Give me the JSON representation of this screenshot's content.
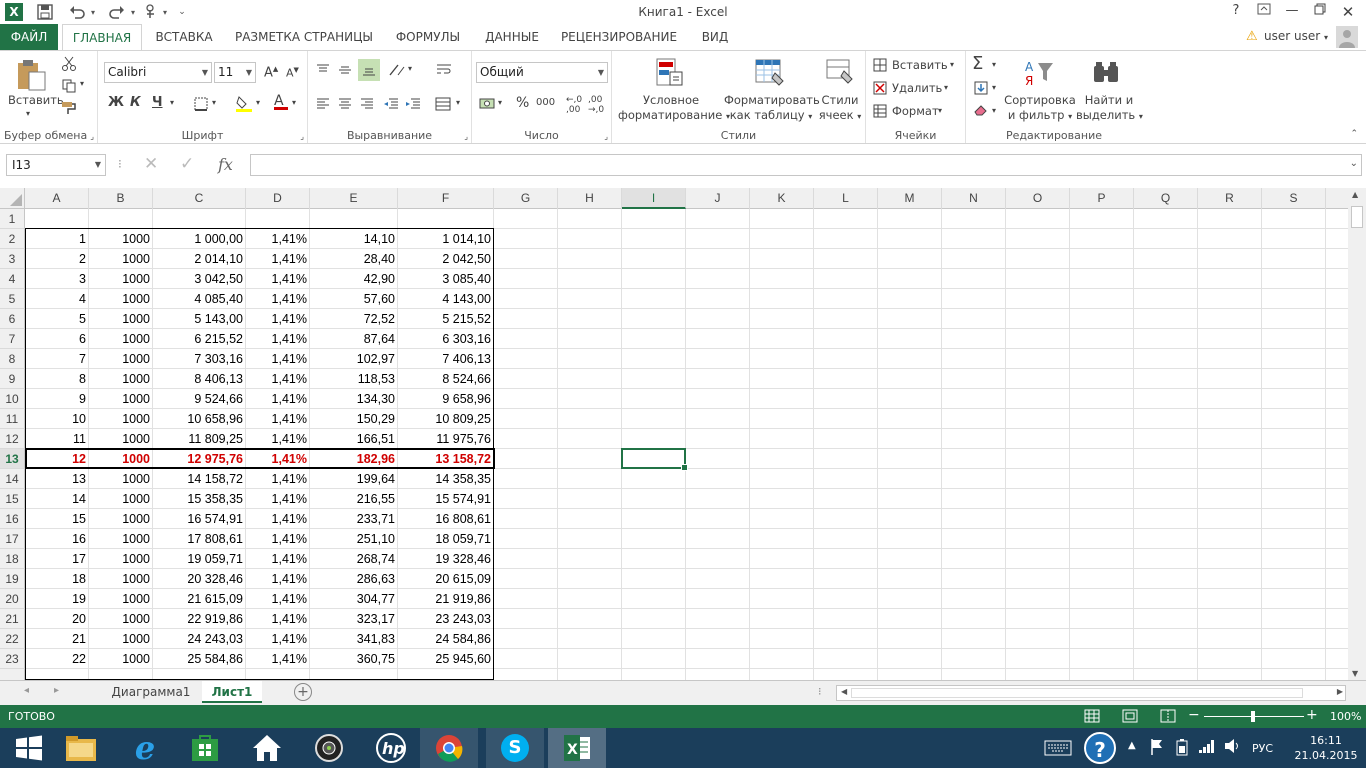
{
  "window": {
    "title": "Книга1 - Excel",
    "help_label": "?",
    "excel_logo": "X"
  },
  "ribbon_tabs": [
    {
      "label": "ФАЙЛ"
    },
    {
      "label": "ГЛАВНАЯ"
    },
    {
      "label": "ВСТАВКА"
    },
    {
      "label": "РАЗМЕТКА СТРАНИЦЫ"
    },
    {
      "label": "ФОРМУЛЫ"
    },
    {
      "label": "ДАННЫЕ"
    },
    {
      "label": "РЕЦЕНЗИРОВАНИЕ"
    },
    {
      "label": "ВИД"
    }
  ],
  "user": {
    "name": "user user"
  },
  "ribbon": {
    "clipboard": {
      "label": "Буфер обмена",
      "paste_label": "Вставить"
    },
    "font": {
      "label": "Шрифт",
      "font_name": "Calibri",
      "font_size": "11",
      "bold": "Ж",
      "italic": "К",
      "underline": "Ч",
      "grow": "A",
      "shrink": "A",
      "font_color": "A"
    },
    "alignment": {
      "label": "Выравнивание"
    },
    "number": {
      "label": "Число",
      "format": "Общий",
      "percent": "%",
      "thousands": "000",
      "currency": "₽"
    },
    "styles": {
      "label": "Стили",
      "conditional": [
        "Условное",
        "форматирование"
      ],
      "as_table": [
        "Форматировать",
        "как таблицу"
      ],
      "cell_styles": [
        "Стили",
        "ячеек"
      ]
    },
    "cells": {
      "label": "Ячейки",
      "insert": "Вставить",
      "delete": "Удалить",
      "format": "Формат"
    },
    "editing": {
      "label": "Редактирование",
      "sum": "Σ",
      "sort": [
        "Сортировка",
        "и фильтр"
      ],
      "find": [
        "Найти и",
        "выделить"
      ]
    }
  },
  "formula_bar": {
    "name_box": "I13",
    "fx": "fx",
    "formula": ""
  },
  "columns": [
    "A",
    "B",
    "C",
    "D",
    "E",
    "F",
    "G",
    "H",
    "I",
    "J",
    "K",
    "L",
    "M",
    "N",
    "O",
    "P",
    "Q",
    "R",
    "S"
  ],
  "selected_cell": {
    "column": "I",
    "row": 13
  },
  "rows": [
    {
      "n": "1",
      "cells": [
        "",
        "",
        "",
        "",
        "",
        ""
      ]
    },
    {
      "n": "2",
      "cells": [
        "1",
        "1000",
        "1 000,00",
        "1,41%",
        "14,10",
        "1 014,10"
      ]
    },
    {
      "n": "3",
      "cells": [
        "2",
        "1000",
        "2 014,10",
        "1,41%",
        "28,40",
        "2 042,50"
      ]
    },
    {
      "n": "4",
      "cells": [
        "3",
        "1000",
        "3 042,50",
        "1,41%",
        "42,90",
        "3 085,40"
      ]
    },
    {
      "n": "5",
      "cells": [
        "4",
        "1000",
        "4 085,40",
        "1,41%",
        "57,60",
        "4 143,00"
      ]
    },
    {
      "n": "6",
      "cells": [
        "5",
        "1000",
        "5 143,00",
        "1,41%",
        "72,52",
        "5 215,52"
      ]
    },
    {
      "n": "7",
      "cells": [
        "6",
        "1000",
        "6 215,52",
        "1,41%",
        "87,64",
        "6 303,16"
      ]
    },
    {
      "n": "8",
      "cells": [
        "7",
        "1000",
        "7 303,16",
        "1,41%",
        "102,97",
        "7 406,13"
      ]
    },
    {
      "n": "9",
      "cells": [
        "8",
        "1000",
        "8 406,13",
        "1,41%",
        "118,53",
        "8 524,66"
      ]
    },
    {
      "n": "10",
      "cells": [
        "9",
        "1000",
        "9 524,66",
        "1,41%",
        "134,30",
        "9 658,96"
      ]
    },
    {
      "n": "11",
      "cells": [
        "10",
        "1000",
        "10 658,96",
        "1,41%",
        "150,29",
        "10 809,25"
      ]
    },
    {
      "n": "12",
      "cells": [
        "11",
        "1000",
        "11 809,25",
        "1,41%",
        "166,51",
        "11 975,76"
      ]
    },
    {
      "n": "13",
      "cells": [
        "12",
        "1000",
        "12 975,76",
        "1,41%",
        "182,96",
        "13 158,72"
      ],
      "highlight": true
    },
    {
      "n": "14",
      "cells": [
        "13",
        "1000",
        "14 158,72",
        "1,41%",
        "199,64",
        "14 358,35"
      ]
    },
    {
      "n": "15",
      "cells": [
        "14",
        "1000",
        "15 358,35",
        "1,41%",
        "216,55",
        "15 574,91"
      ]
    },
    {
      "n": "16",
      "cells": [
        "15",
        "1000",
        "16 574,91",
        "1,41%",
        "233,71",
        "16 808,61"
      ]
    },
    {
      "n": "17",
      "cells": [
        "16",
        "1000",
        "17 808,61",
        "1,41%",
        "251,10",
        "18 059,71"
      ]
    },
    {
      "n": "18",
      "cells": [
        "17",
        "1000",
        "19 059,71",
        "1,41%",
        "268,74",
        "19 328,46"
      ]
    },
    {
      "n": "19",
      "cells": [
        "18",
        "1000",
        "20 328,46",
        "1,41%",
        "286,63",
        "20 615,09"
      ]
    },
    {
      "n": "20",
      "cells": [
        "19",
        "1000",
        "21 615,09",
        "1,41%",
        "304,77",
        "21 919,86"
      ]
    },
    {
      "n": "21",
      "cells": [
        "20",
        "1000",
        "22 919,86",
        "1,41%",
        "323,17",
        "23 243,03"
      ]
    },
    {
      "n": "22",
      "cells": [
        "21",
        "1000",
        "24 243,03",
        "1,41%",
        "341,83",
        "24 584,86"
      ]
    },
    {
      "n": "23",
      "cells": [
        "22",
        "1000",
        "25 584,86",
        "1,41%",
        "360,75",
        "25 945,60"
      ]
    }
  ],
  "sheet_tabs": [
    {
      "label": "Диаграмма1"
    },
    {
      "label": "Лист1",
      "active": true
    }
  ],
  "status": {
    "ready": "ГОТОВО",
    "zoom": "100%"
  },
  "taskbar": {
    "lang": "РУС",
    "time": "16:11",
    "date": "21.04.2015",
    "help": "?"
  },
  "colors": {
    "excel_green": "#217346",
    "highlight_red": "#d00000",
    "taskbar": "#1b3e5b"
  }
}
